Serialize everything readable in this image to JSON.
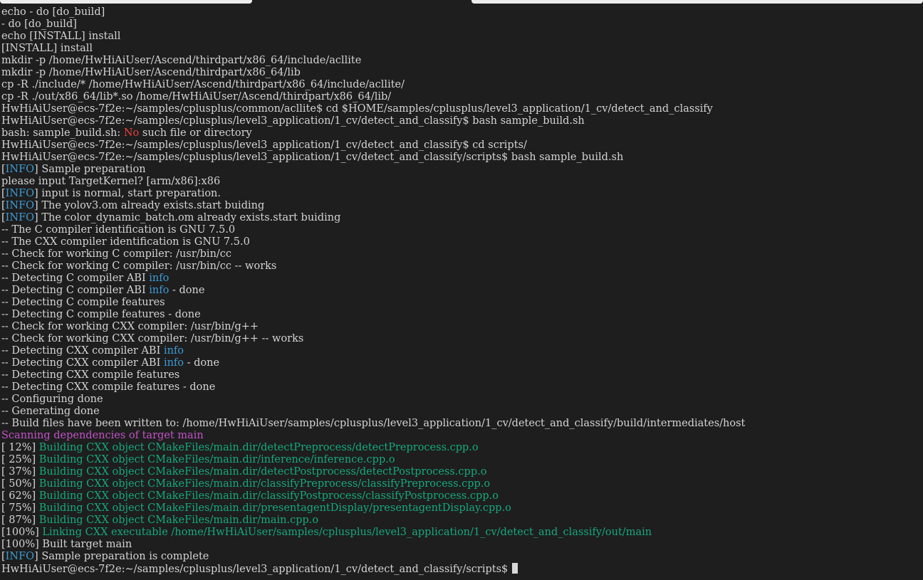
{
  "colors": {
    "background": "#1e1e1e",
    "default": "#d4d4d4",
    "blue": "#3d9bd4",
    "red": "#e8403c",
    "magenta": "#c352c8",
    "green": "#16a97c",
    "cursor": "#d8d8d8",
    "strip": "#ececec"
  },
  "lines": [
    [
      {
        "t": "echo - do [do_build]"
      }
    ],
    [
      {
        "t": "- do [do_build]"
      }
    ],
    [
      {
        "t": "echo [INSTALL] install"
      }
    ],
    [
      {
        "t": "[INSTALL] install"
      }
    ],
    [
      {
        "t": "mkdir -p /home/HwHiAiUser/Ascend/thirdpart/x86_64/include/acllite"
      }
    ],
    [
      {
        "t": "mkdir -p /home/HwHiAiUser/Ascend/thirdpart/x86_64/lib"
      }
    ],
    [
      {
        "t": "cp -R ./include/* /home/HwHiAiUser/Ascend/thirdpart/x86_64/include/acllite/"
      }
    ],
    [
      {
        "t": "cp -R ./out/x86_64/lib*.so /home/HwHiAiUser/Ascend/thirdpart/x86_64/lib/"
      }
    ],
    [
      {
        "t": "HwHiAiUser@ecs-7f2e:~/samples/cplusplus/common/acllite$ cd $HOME/samples/cplusplus/level3_application/1_cv/detect_and_classify"
      }
    ],
    [
      {
        "t": "HwHiAiUser@ecs-7f2e:~/samples/cplusplus/level3_application/1_cv/detect_and_classify$ bash sample_build.sh"
      }
    ],
    [
      {
        "t": "bash: sample_build.sh: "
      },
      {
        "t": "No",
        "c": "red"
      },
      {
        "t": " such file or directory"
      }
    ],
    [
      {
        "t": "HwHiAiUser@ecs-7f2e:~/samples/cplusplus/level3_application/1_cv/detect_and_classify$ cd scripts/"
      }
    ],
    [
      {
        "t": "HwHiAiUser@ecs-7f2e:~/samples/cplusplus/level3_application/1_cv/detect_and_classify/scripts$ bash sample_build.sh"
      }
    ],
    [
      {
        "t": "["
      },
      {
        "t": "INFO",
        "c": "blue"
      },
      {
        "t": "] Sample preparation"
      }
    ],
    [
      {
        "t": "please input TargetKernel? [arm/x86]:x86"
      }
    ],
    [
      {
        "t": "["
      },
      {
        "t": "INFO",
        "c": "blue"
      },
      {
        "t": "] input is normal, start preparation."
      }
    ],
    [
      {
        "t": "["
      },
      {
        "t": "INFO",
        "c": "blue"
      },
      {
        "t": "] The yolov3.om already exists.start buiding"
      }
    ],
    [
      {
        "t": "["
      },
      {
        "t": "INFO",
        "c": "blue"
      },
      {
        "t": "] The color_dynamic_batch.om already exists.start buiding"
      }
    ],
    [
      {
        "t": "-- The C compiler identification is GNU 7.5.0"
      }
    ],
    [
      {
        "t": "-- The CXX compiler identification is GNU 7.5.0"
      }
    ],
    [
      {
        "t": "-- Check for working C compiler: /usr/bin/cc"
      }
    ],
    [
      {
        "t": "-- Check for working C compiler: /usr/bin/cc -- works"
      }
    ],
    [
      {
        "t": "-- Detecting C compiler ABI "
      },
      {
        "t": "info",
        "c": "blue"
      }
    ],
    [
      {
        "t": "-- Detecting C compiler ABI "
      },
      {
        "t": "info",
        "c": "blue"
      },
      {
        "t": " - done"
      }
    ],
    [
      {
        "t": "-- Detecting C compile features"
      }
    ],
    [
      {
        "t": "-- Detecting C compile features - done"
      }
    ],
    [
      {
        "t": "-- Check for working CXX compiler: /usr/bin/g++"
      }
    ],
    [
      {
        "t": "-- Check for working CXX compiler: /usr/bin/g++ -- works"
      }
    ],
    [
      {
        "t": "-- Detecting CXX compiler ABI "
      },
      {
        "t": "info",
        "c": "blue"
      }
    ],
    [
      {
        "t": "-- Detecting CXX compiler ABI "
      },
      {
        "t": "info",
        "c": "blue"
      },
      {
        "t": " - done"
      }
    ],
    [
      {
        "t": "-- Detecting CXX compile features"
      }
    ],
    [
      {
        "t": "-- Detecting CXX compile features - done"
      }
    ],
    [
      {
        "t": "-- Configuring done"
      }
    ],
    [
      {
        "t": "-- Generating done"
      }
    ],
    [
      {
        "t": "-- Build files have been written to: /home/HwHiAiUser/samples/cplusplus/level3_application/1_cv/detect_and_classify/build/intermediates/host"
      }
    ],
    [
      {
        "t": "Scanning dependencies of target main",
        "c": "magenta"
      }
    ],
    [
      {
        "t": "[ 12%] "
      },
      {
        "t": "Building CXX object CMakeFiles/main.dir/detectPreprocess/detectPreprocess.cpp.o",
        "c": "green"
      }
    ],
    [
      {
        "t": "[ 25%] "
      },
      {
        "t": "Building CXX object CMakeFiles/main.dir/inference/inference.cpp.o",
        "c": "green"
      }
    ],
    [
      {
        "t": "[ 37%] "
      },
      {
        "t": "Building CXX object CMakeFiles/main.dir/detectPostprocess/detectPostprocess.cpp.o",
        "c": "green"
      }
    ],
    [
      {
        "t": "[ 50%] "
      },
      {
        "t": "Building CXX object CMakeFiles/main.dir/classifyPreprocess/classifyPreprocess.cpp.o",
        "c": "green"
      }
    ],
    [
      {
        "t": "[ 62%] "
      },
      {
        "t": "Building CXX object CMakeFiles/main.dir/classifyPostprocess/classifyPostprocess.cpp.o",
        "c": "green"
      }
    ],
    [
      {
        "t": "[ 75%] "
      },
      {
        "t": "Building CXX object CMakeFiles/main.dir/presentagentDisplay/presentagentDisplay.cpp.o",
        "c": "green"
      }
    ],
    [
      {
        "t": "[ 87%] "
      },
      {
        "t": "Building CXX object CMakeFiles/main.dir/main.cpp.o",
        "c": "green"
      }
    ],
    [
      {
        "t": "[100%] "
      },
      {
        "t": "Linking CXX executable /home/HwHiAiUser/samples/cplusplus/level3_application/1_cv/detect_and_classify/out/main",
        "c": "green"
      }
    ],
    [
      {
        "t": "[100%] Built target main"
      }
    ],
    [
      {
        "t": "["
      },
      {
        "t": "INFO",
        "c": "blue"
      },
      {
        "t": "] Sample preparation is complete"
      }
    ]
  ],
  "prompt": "HwHiAiUser@ecs-7f2e:~/samples/cplusplus/level3_application/1_cv/detect_and_classify/scripts$ "
}
